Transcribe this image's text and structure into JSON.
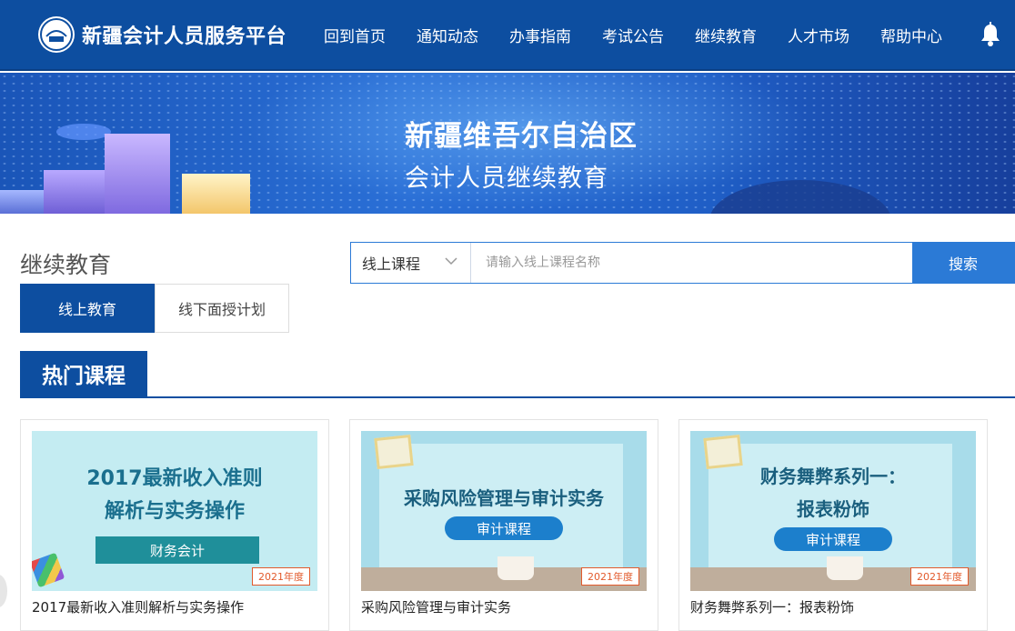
{
  "header": {
    "logo_title": "新疆会计人员服务平台",
    "nav": [
      "回到首页",
      "通知动态",
      "办事指南",
      "考试公告",
      "继续教育",
      "人才市场",
      "帮助中心"
    ]
  },
  "banner": {
    "line1": "新疆维吾尔自治区",
    "line2": "会计人员继续教育"
  },
  "section": {
    "title": "继续教育",
    "tabs": [
      {
        "label": "线上教育",
        "active": true
      },
      {
        "label": "线下面授计划",
        "active": false
      }
    ]
  },
  "search": {
    "select_value": "线上课程",
    "placeholder": "请输入线上课程名称",
    "button": "搜索"
  },
  "hot": {
    "label": "热门课程"
  },
  "courses": [
    {
      "image_title_1": "2017最新收入准则",
      "image_title_2": "解析与实务操作",
      "ribbon": "财务会计",
      "year": "2021年度",
      "name": "2017最新收入准则解析与实务操作"
    },
    {
      "image_title_1": "采购风险管理与审计实务",
      "ribbon": "审计课程",
      "year": "2021年度",
      "name": "采购风险管理与审计实务"
    },
    {
      "image_title_1": "财务舞弊系列一：",
      "image_title_2": "报表粉饰",
      "ribbon": "审计课程",
      "year": "2021年度",
      "name": "财务舞弊系列一：报表粉饰"
    }
  ],
  "colors": {
    "primary": "#0d4ea0",
    "accent": "#2b7ad6"
  }
}
